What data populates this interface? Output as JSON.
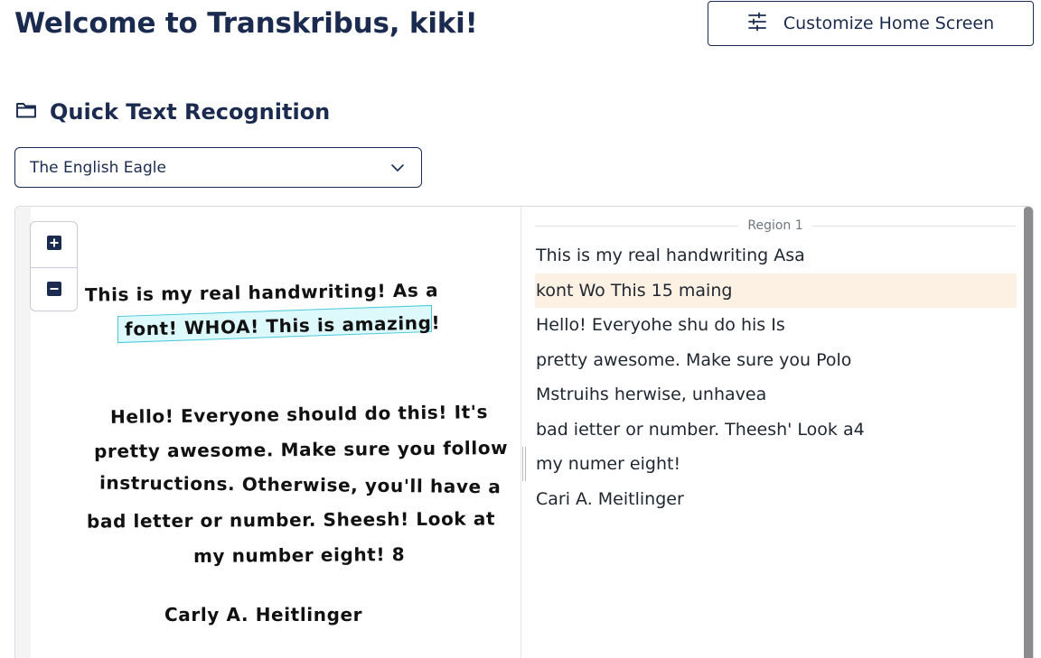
{
  "header": {
    "title": "Welcome to Transkribus, kiki!",
    "customize_label": "Customize Home Screen",
    "customize_icon": "sliders-icon"
  },
  "section": {
    "title": "Quick Text Recognition",
    "icon": "folder-icon"
  },
  "model_select": {
    "value": "The English Eagle",
    "icon": "chevron-down-icon"
  },
  "viewer": {
    "zoom_in_icon": "plus-square-icon",
    "zoom_out_icon": "minus-square-icon",
    "handwriting_lines": [
      "This is my real handwriting! As a",
      "font! WHOA! This is amazing!",
      "Hello! Everyone should do this! It's",
      "pretty awesome. Make sure you follow",
      "instructions. Otherwise, you'll have a",
      "bad letter or number. Sheesh! Look at",
      "my number eight! 8",
      "Carly A. Heitlinger"
    ],
    "region_label": "Region 1",
    "transcription_lines": [
      "This is my real handwriting Asa",
      "kont Wo This 15 maing",
      "Hello! Everyohe shu do his Is",
      "pretty awesome. Make sure you Polo",
      "Mstruihs herwise, unhavea",
      "bad ietter or number. Theesh' Look a4",
      "my numer eight!",
      "Cari A. Meitlinger"
    ],
    "active_line_index": 1,
    "colors": {
      "selection_outline": "#4cc9d9",
      "active_line_bg": "#fdf1e3",
      "brand_navy": "#1b2b50"
    }
  }
}
